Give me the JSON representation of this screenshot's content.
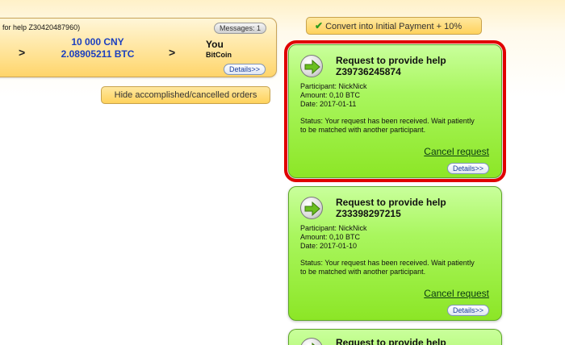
{
  "order": {
    "title": "for help Z30420487960)",
    "messages": "Messages: 1",
    "arrow1": ">",
    "arrow2": ">",
    "amount_cny": "10 000 CNY",
    "amount_btc": "2.08905211 BTC",
    "recipient_name": "You",
    "recipient_wallet": "BitCoin",
    "details": "Details>>"
  },
  "convert_button": {
    "icon": "checkmark-icon",
    "label": "Convert into Initial Payment + 10%"
  },
  "hide_button": {
    "label": "Hide accomplished/cancelled orders"
  },
  "requests": [
    {
      "title": "Request to provide help",
      "id": "Z39736245874",
      "participant": "Participant: NickNick",
      "amount": "Amount: 0,10 BTC",
      "date": "Date: 2017-01-11",
      "status": "Status: Your request has been received. Wait patiently to be matched with another participant.",
      "cancel": "Cancel request",
      "details": "Details>>",
      "highlighted": true
    },
    {
      "title": "Request to provide help",
      "id": "Z33398297215",
      "participant": "Participant: NickNick",
      "amount": "Amount: 0,10 BTC",
      "date": "Date: 2017-01-10",
      "status": "Status: Your request has been received. Wait patiently to be matched with another participant.",
      "cancel": "Cancel request",
      "details": "Details>>",
      "highlighted": false
    },
    {
      "title": "Request to provide help"
    }
  ],
  "colors": {
    "card_green": "#a9f65e",
    "highlight_red": "#e00000",
    "pill_yellow": "#ffd25c",
    "amount_blue": "#1b3fbf"
  }
}
